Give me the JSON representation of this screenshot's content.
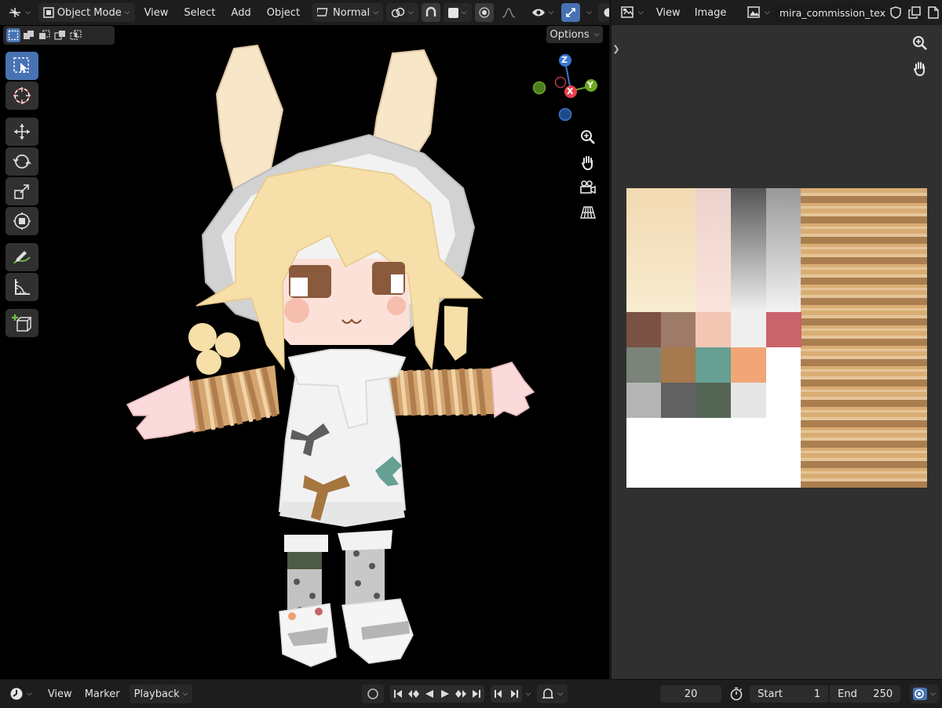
{
  "viewport": {
    "header": {
      "mode_label": "Object Mode",
      "menus": [
        "View",
        "Select",
        "Add",
        "Object"
      ],
      "transform_orientation": "Normal"
    },
    "options_label": "Options",
    "gizmo": {
      "z": "Z",
      "x": "X",
      "y": "Y"
    }
  },
  "image_editor": {
    "menus": [
      "View",
      "Image"
    ],
    "image_name": "mira_commission_text.png"
  },
  "timeline": {
    "menus": [
      "View",
      "Marker"
    ],
    "playback_label": "Playback",
    "current_frame": "20",
    "start_label": "Start",
    "start_value": "1",
    "end_label": "End",
    "end_value": "250"
  },
  "colors": {
    "accent": "#4772b3",
    "axis_x": "#e7414e",
    "axis_y": "#6fa620",
    "axis_z": "#3a78d1"
  },
  "icons": [
    "editor-type-3d-icon",
    "object-mode-icon",
    "transform-orientation-icon",
    "pivot-icon",
    "snap-icon",
    "proportional-icon",
    "visibility-icon",
    "gizmo-icon",
    "overlay-icon",
    "shading-icon",
    "select-box-icon",
    "cursor-icon",
    "move-icon",
    "rotate-icon",
    "scale-icon",
    "transform-icon",
    "annotate-icon",
    "measure-icon",
    "add-cube-icon",
    "zoom-icon",
    "hand-icon",
    "camera-icon",
    "grid-icon",
    "image-editor-icon",
    "image-icon",
    "shield-icon",
    "duplicate-icon",
    "new-image-icon",
    "timeline-icon",
    "keyframe-icon",
    "stopwatch-icon",
    "autokey-icon"
  ]
}
